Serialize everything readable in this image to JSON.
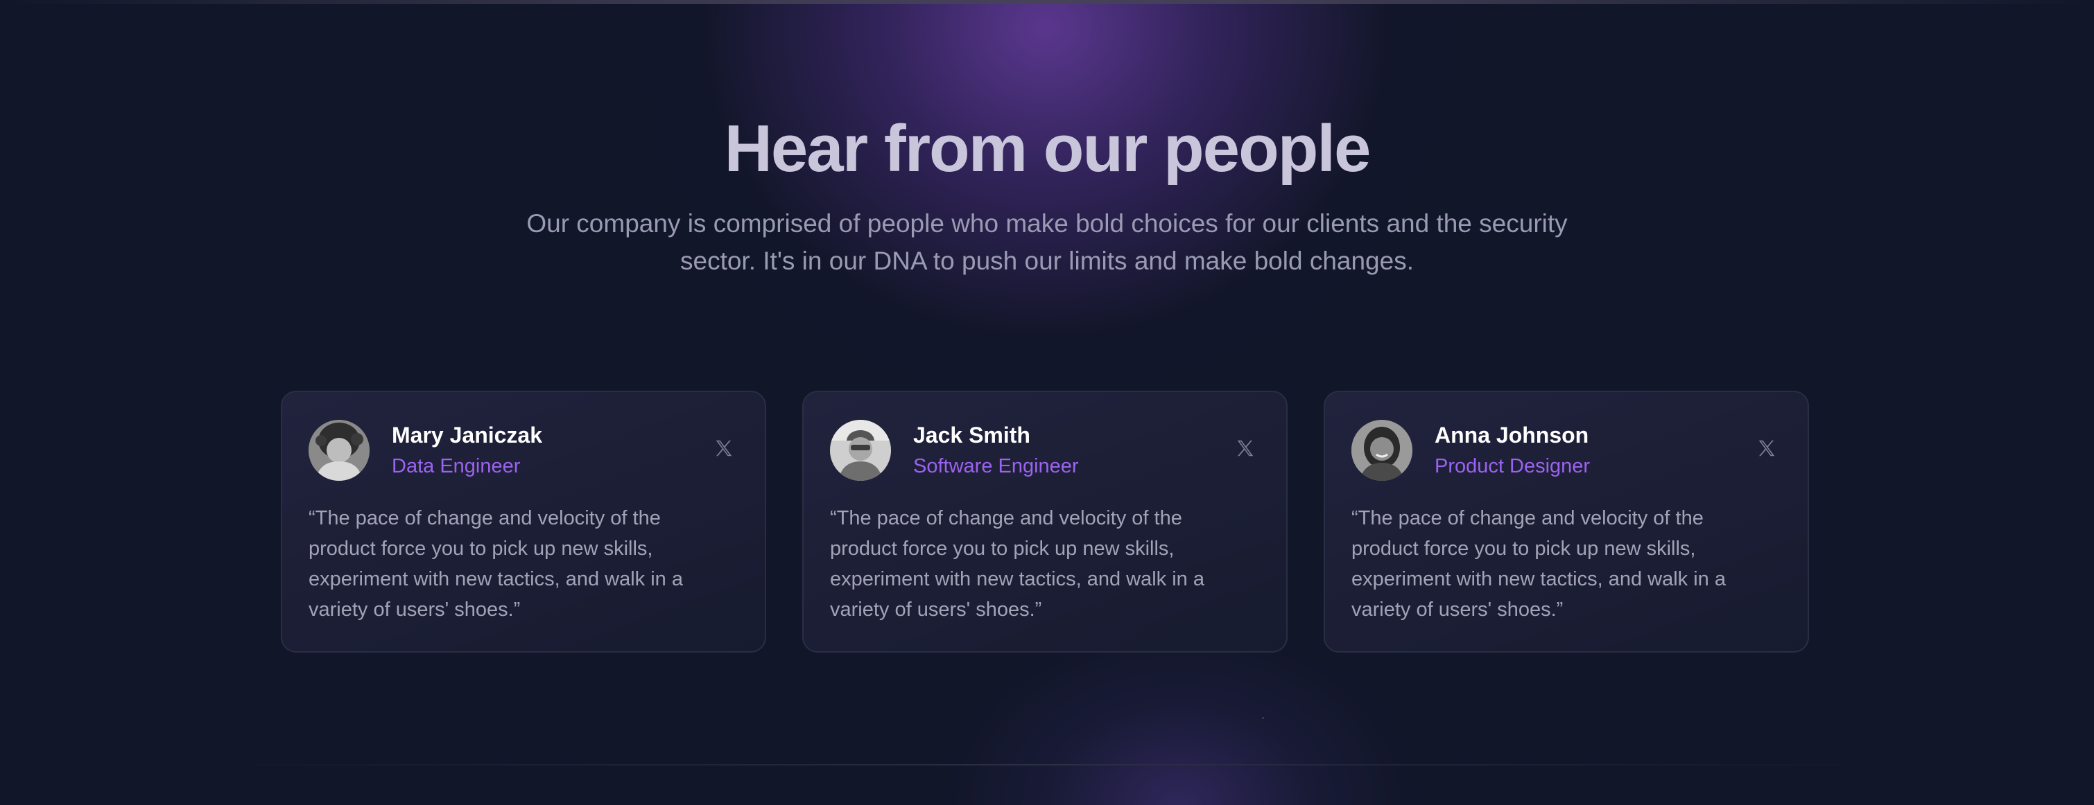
{
  "section": {
    "heading": "Hear from our people",
    "subtitle": "Our company is comprised of people who make bold choices for our clients and the security sector. It's in our DNA to push our limits and make bold changes."
  },
  "testimonials": [
    {
      "name": "Mary Janiczak",
      "role": "Data Engineer",
      "quote": "“The pace of change and velocity of the product force you to pick up new skills, experiment with new tactics, and walk in a variety of users' shoes.”",
      "social_icon": "x-logo-icon",
      "social_link_label": "X"
    },
    {
      "name": "Jack Smith",
      "role": "Software Engineer",
      "quote": "“The pace of change and velocity of the product force you to pick up new skills, experiment with new tactics, and walk in a variety of users' shoes.”",
      "social_icon": "x-logo-icon",
      "social_link_label": "X"
    },
    {
      "name": "Anna Johnson",
      "role": "Product Designer",
      "quote": "“The pace of change and velocity of the product force you to pick up new skills, experiment with new tactics, and walk in a variety of users' shoes.”",
      "social_icon": "x-logo-icon",
      "social_link_label": "X"
    }
  ],
  "colors": {
    "background": "#121629",
    "heading": "#c9c6dc",
    "subtitle": "#9a9bb3",
    "role_accent": "#9b63f0",
    "name": "#ffffff",
    "quote": "#a3a3b8",
    "card_border": "#2a2e45"
  }
}
